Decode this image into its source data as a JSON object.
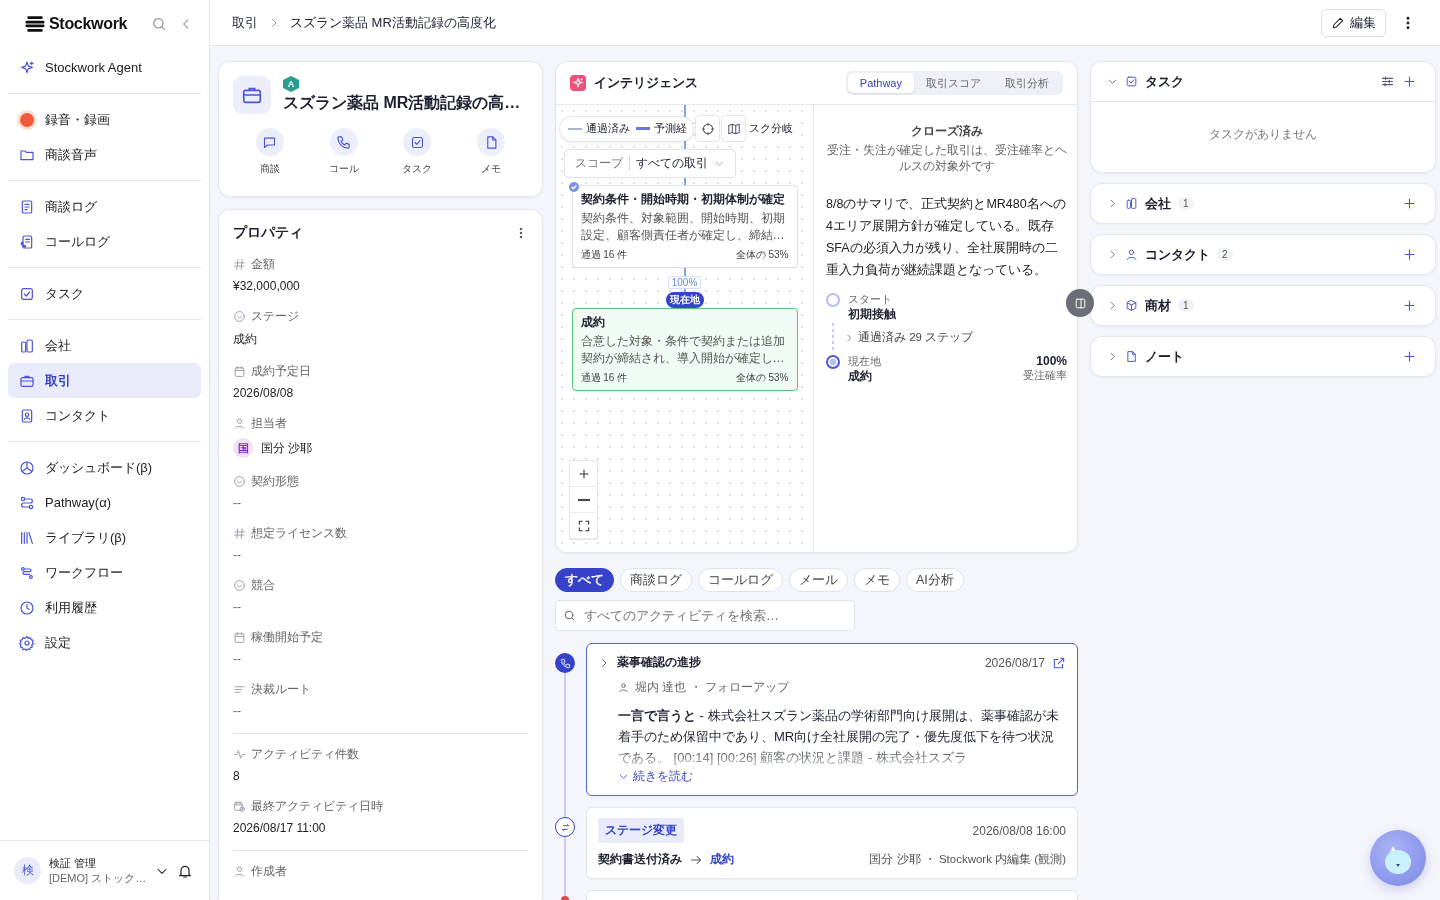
{
  "app": {
    "logo": "Stockwork"
  },
  "sidebar": {
    "groups": [
      {
        "items": [
          {
            "label": "Stockwork Agent",
            "selected": false
          }
        ]
      },
      {
        "items": [
          {
            "label": "録音・録画",
            "selected": false
          },
          {
            "label": "商談音声",
            "selected": false
          }
        ]
      },
      {
        "items": [
          {
            "label": "商談ログ",
            "selected": false
          },
          {
            "label": "コールログ",
            "selected": false
          }
        ]
      },
      {
        "items": [
          {
            "label": "タスク",
            "selected": false
          }
        ]
      },
      {
        "items": [
          {
            "label": "会社",
            "selected": false
          },
          {
            "label": "取引",
            "selected": true
          },
          {
            "label": "コンタクト",
            "selected": false
          }
        ]
      },
      {
        "items": [
          {
            "label": "ダッシュボード(β)",
            "selected": false
          },
          {
            "label": "Pathway(α)",
            "selected": false
          },
          {
            "label": "ライブラリ(β)",
            "selected": false
          },
          {
            "label": "ワークフロー",
            "selected": false
          },
          {
            "label": "利用履歴",
            "selected": false
          },
          {
            "label": "設定",
            "selected": false
          }
        ]
      }
    ],
    "user": {
      "avatar": "検",
      "name": "検証 管理",
      "org": "[DEMO] ストック…"
    }
  },
  "breadcrumb": [
    "取引",
    "スズラン薬品 MR活動記録の高度化"
  ],
  "toolbar": {
    "edit": "編集"
  },
  "deal": {
    "badge": "A",
    "title": "スズラン薬品 MR活動記録の高…",
    "actions": [
      "商談",
      "コール",
      "タスク",
      "メモ"
    ]
  },
  "properties": {
    "title": "プロパティ",
    "sections": [
      {
        "fields": [
          {
            "label": "金額",
            "kind": "number",
            "value": "¥32,000,000"
          },
          {
            "label": "ステージ",
            "kind": "select",
            "value": "成約"
          },
          {
            "label": "成約予定日",
            "kind": "date",
            "value": "2026/08/08"
          },
          {
            "label": "担当者",
            "kind": "user",
            "avatar": "国",
            "value": "国分 沙耶"
          },
          {
            "label": "契約形態",
            "kind": "select",
            "value": "--"
          },
          {
            "label": "想定ライセンス数",
            "kind": "number",
            "value": "--"
          },
          {
            "label": "競合",
            "kind": "select",
            "value": "--"
          },
          {
            "label": "稼働開始予定",
            "kind": "date",
            "value": "--"
          },
          {
            "label": "決裁ルート",
            "kind": "text",
            "value": "--"
          }
        ]
      },
      {
        "fields": [
          {
            "label": "アクティビティ件数",
            "kind": "activity",
            "value": "8"
          },
          {
            "label": "最終アクティビティ日時",
            "kind": "datetime",
            "value": "2026/08/17 11:00"
          }
        ]
      },
      {
        "fields": [
          {
            "label": "作成者",
            "kind": "user"
          }
        ]
      }
    ]
  },
  "intelligence": {
    "title": "インテリジェンス",
    "tabs": [
      {
        "label": "Pathway",
        "selected": true
      },
      {
        "label": "取引スコア",
        "selected": false
      },
      {
        "label": "取引分析",
        "selected": false
      }
    ],
    "legend": [
      {
        "label": "通過済み",
        "kind": "passed"
      },
      {
        "label": "予測経",
        "kind": "predicted"
      }
    ],
    "legend_tail": "スク分岐",
    "scope": {
      "label": "スコープ",
      "value": "すべての取引"
    },
    "nodes": [
      {
        "title": "契約条件・開始時期・初期体制が確定",
        "description": "契約条件、対象範囲、開始時期、初期設定、顧客側責任者が確定し、締結…",
        "passed": "通過 16 件",
        "share": "全体の 53%",
        "done": true,
        "current": false
      },
      {
        "title": "成約",
        "description": "合意した対象・条件で契約または追加契約が締結され、導入開始が確定し…",
        "passed": "通過 16 件",
        "share": "全体の 53%",
        "done": false,
        "current": true
      }
    ],
    "connector": {
      "percent": "100%",
      "marker": "現在地"
    },
    "status": {
      "title": "クローズ済み",
      "note": "受注・失注が確定した取引は、受注確率とヘルスの対象外です",
      "summary": "8/8のサマリで、正式契約とMR480名への4エリア展開方針が確定している。既存SFAの必須入力が残り、全社展開時の二重入力負荷が継続課題となっている。",
      "start": {
        "caption": "スタート",
        "stage": "初期接触"
      },
      "passed_steps": "通過済み 29 ステップ",
      "current": {
        "caption": "現在地",
        "stage": "成約",
        "probability": "100%",
        "probability_label": "受注確率"
      }
    }
  },
  "activity": {
    "filters": [
      {
        "label": "すべて",
        "selected": true
      },
      {
        "label": "商談ログ",
        "selected": false
      },
      {
        "label": "コールログ",
        "selected": false
      },
      {
        "label": "メール",
        "selected": false
      },
      {
        "label": "メモ",
        "selected": false
      },
      {
        "label": "AI分析",
        "selected": false
      }
    ],
    "search": {
      "placeholder": "すべてのアクティビティを検索…"
    },
    "items": [
      {
        "kind": "call",
        "selected": true,
        "title": "薬事確認の進捗",
        "date": "2026/08/17",
        "meta": "堀内 達也 ・ フォローアップ",
        "body": "**一言で言うと** - 株式会社スズラン薬品の学術部門向け展開は、薬事確認が未着手のため保留中であり、MR向け全社展開の完了・優先度低下を待つ状況である。 [00:14] [00:26] 顧客の状況と課題 - 株式会社スズラ",
        "more": "続きを読む"
      },
      {
        "kind": "stage_change",
        "selected": false,
        "tag": "ステージ変更",
        "date": "2026/08/08 16:00",
        "from": "契約書送付済み",
        "to": "成約",
        "meta": "国分 沙耶 ・ Stockwork 内編集 (観測)"
      },
      {
        "kind": "other",
        "selected": false
      }
    ]
  },
  "right_sections": [
    {
      "title": "タスク",
      "expanded": true,
      "empty": "タスクがありません"
    },
    {
      "title": "会社",
      "expanded": false,
      "count": "1"
    },
    {
      "title": "コンタクト",
      "expanded": false,
      "count": "2"
    },
    {
      "title": "商材",
      "expanded": false,
      "count": "1"
    },
    {
      "title": "ノート",
      "expanded": false
    }
  ]
}
